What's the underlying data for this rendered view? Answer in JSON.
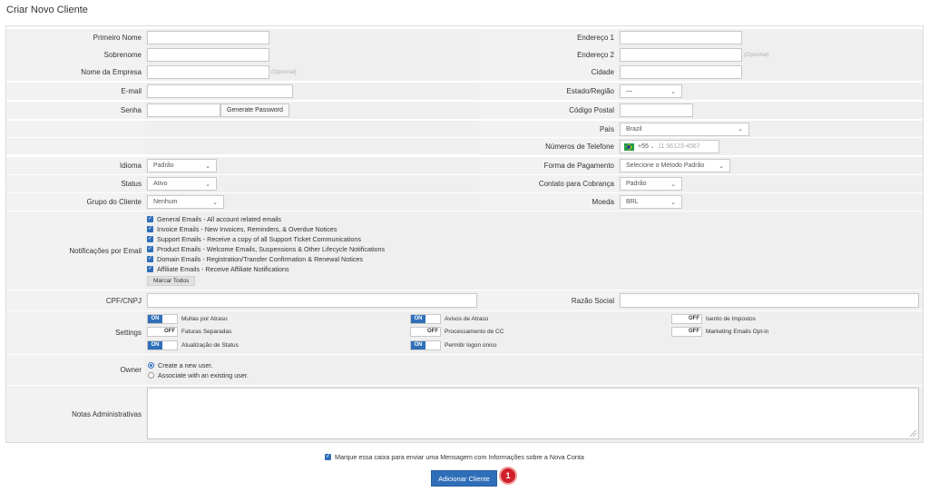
{
  "title": "Criar Novo Cliente",
  "left": {
    "first_name": "Primeiro Nome",
    "last_name": "Sobrenome",
    "company": "Nome da Empresa",
    "company_hint": "(Opcional)",
    "email": "E-mail",
    "password": "Senha",
    "generate_password": "Generate Password",
    "language": "Idioma",
    "language_value": "Padrão",
    "status": "Status",
    "status_value": "Ativo",
    "client_group": "Grupo do Cliente",
    "client_group_value": "Nenhum"
  },
  "right": {
    "address1": "Endereço 1",
    "address2": "Endereço 2",
    "address2_hint": "(Opcional)",
    "city": "Cidade",
    "state": "Estado/Região",
    "state_value": "—",
    "postcode": "Código Postal",
    "country": "País",
    "country_value": "Brazil",
    "phone": "Números de Telefone",
    "phone_code": "+55",
    "phone_placeholder": "11 96123-4567",
    "payment_method": "Forma de Pagamento",
    "payment_method_value": "Selecione o Método Padrão",
    "billing_contact": "Contato para Cobrança",
    "billing_contact_value": "Padrão",
    "currency": "Moeda",
    "currency_value": "BRL"
  },
  "notifications": {
    "label": "Notificações por Email",
    "items": [
      "General Emails - All account related emails",
      "Invoice Emails - New Invoices, Reminders, & Overdue Notices",
      "Support Emails - Receive a copy of all Support Ticket Communications",
      "Product Emails - Welcome Emails, Suspensions & Other Lifecycle Notifications",
      "Domain Emails - Registration/Transfer Confirmation & Renewal Notices",
      "Affiliate Emails - Receive Affiliate Notifications"
    ],
    "mark_all": "Marcar Todos"
  },
  "cpf": "CPF/CNPJ",
  "razao": "Razão Social",
  "settings": {
    "label": "Settings",
    "on": "ON",
    "off": "OFF",
    "late_fees": "Multas por Atraso",
    "overdue_notices": "Avisos de Atraso",
    "tax_exempt": "Isento de Impostos",
    "separate_invoices": "Faturas Separadas",
    "cc_processing": "Processamento de CC",
    "marketing_optin": "Marketing Emails Opt-in",
    "status_update": "Atualização de Status",
    "single_signon": "Permitir logon único"
  },
  "owner": {
    "label": "Owner",
    "create": "Create a new user.",
    "associate": "Associate with an existing user."
  },
  "notes": "Notas Administrativas",
  "confirm_text": "Marque essa caixa para enviar uma Mensagem com Informações sobre a Nova Conta",
  "submit": "Adicionar Cliente",
  "badge": "1",
  "colors": {
    "accent": "#2f6fba",
    "badge": "#d0202a"
  },
  "icons": {
    "check": "✓",
    "chevron": "⌄"
  }
}
